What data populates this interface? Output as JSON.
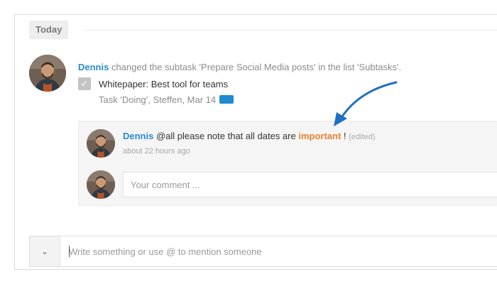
{
  "feed": {
    "day_label": "Today"
  },
  "activity": {
    "user": "Dennis",
    "action_text": " changed the subtask 'Prepare Social Media posts' in the list 'Subtasks'.",
    "subtask": {
      "checked": true,
      "check_glyph": "✓",
      "title": "Whitepaper: Best tool for teams",
      "meta": "Task 'Doing', Steffen, Mar 14",
      "tag_color": "#1e8ad0"
    }
  },
  "comment": {
    "user": "Dennis",
    "text_before": " @all please note that all dates are ",
    "highlight": "important",
    "text_after": " ! ",
    "edited_label": "(edited)",
    "time": "about 22 hours ago"
  },
  "reply": {
    "placeholder": "Your comment ..."
  },
  "composer": {
    "toggle_icon": "chevron-down-icon",
    "toggle_glyph": "⌄",
    "placeholder": "Write something or use @ to mention someone"
  },
  "colors": {
    "link": "#2a8cc9",
    "highlight": "#e8822a",
    "annotation_arrow": "#1f6fc4"
  }
}
